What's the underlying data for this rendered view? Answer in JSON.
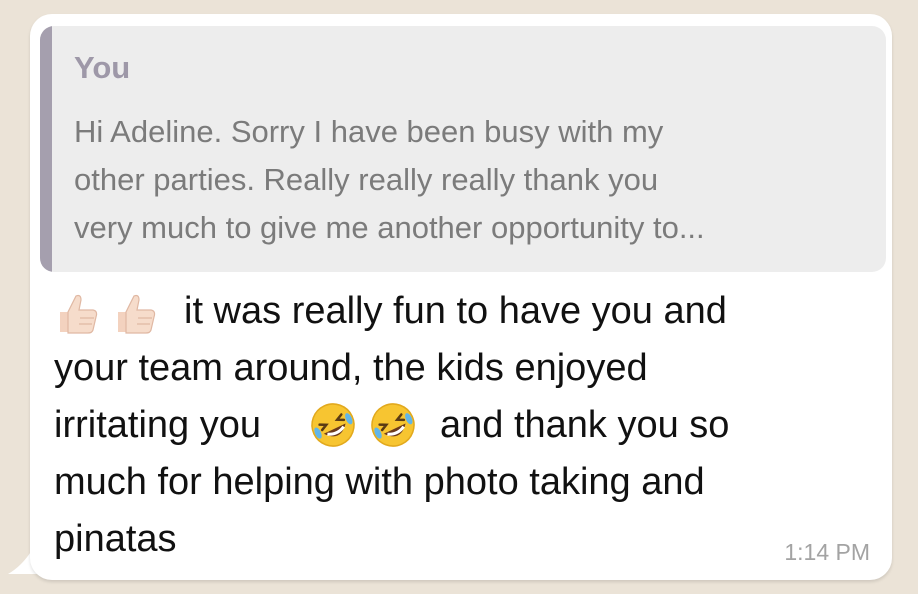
{
  "quote": {
    "author": "You",
    "text": "Hi Adeline. Sorry I have been busy with my\nother parties. Really really really thank you\nvery much to give me another opportunity to..."
  },
  "message": {
    "lines": [
      "it was really fun to have you and",
      "your team around, the kids enjoyed",
      "irritating you",
      "and thank you so",
      "much for helping with photo taking and",
      "pinatas"
    ],
    "emojis": [
      "thumbs-up-icon",
      "thumbs-up-icon",
      "rolling-on-floor-laughing-icon",
      "rolling-on-floor-laughing-icon"
    ]
  },
  "time": "1:14 PM",
  "colors": {
    "bubble": "#ffffff",
    "quote_bg": "#ededed",
    "quote_bar": "#a59fae",
    "wallpaper": "#ebe3d7"
  }
}
